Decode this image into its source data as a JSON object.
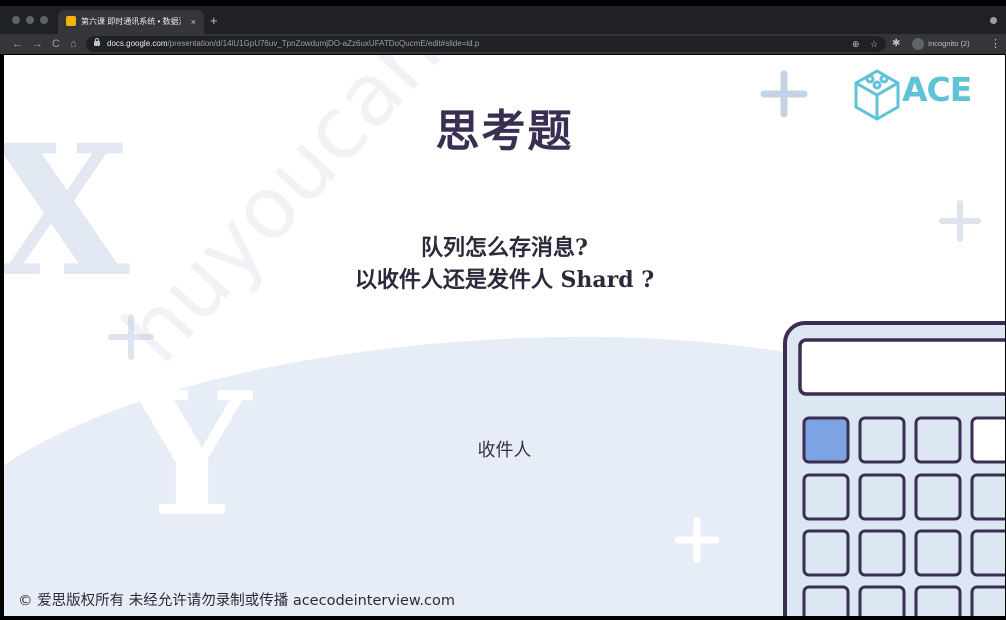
{
  "browser": {
    "tab_title": "第六课 即时通讯系统 • 数据流...",
    "tab_close": "×",
    "new_tab": "+",
    "nav_back": "←",
    "nav_forward": "→",
    "nav_reload": "C",
    "nav_home": "⌂",
    "url_host": "docs.google.com",
    "url_path": "/presentation/d/14iU1GpU76uv_TpnZowdumjDO-aZz6uxUFATDoQucmE/edit#slide=id.p",
    "zoom_icon": "⊕",
    "star_icon": "☆",
    "extensions_icon": "✱",
    "incognito_label": "Incognito (2)",
    "menu_icon": "⋮"
  },
  "slide": {
    "title": "思考题",
    "question_line1": "队列怎么存消息?",
    "question_line2": "以收件人还是发件人 Shard ?",
    "answer": "收件人",
    "copyright": "© 爱思版权所有 未经允许请勿录制或传播 acecodeinterview.com",
    "logo_text": "ACE",
    "watermark": "huyoucan.huxin",
    "deco_x": "X",
    "deco_y": "Y"
  },
  "colors": {
    "title": "#3a2f52",
    "logo": "#5fc2d7",
    "calculator_outline": "#3a2f52",
    "calculator_body": "#dde6f3",
    "calculator_active_key": "#7ea3e4",
    "blob": "#e7edf6"
  }
}
